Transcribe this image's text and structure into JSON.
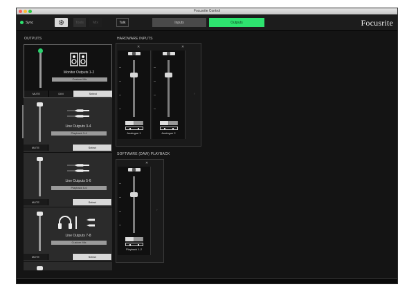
{
  "app": {
    "title": "Focusrite Control"
  },
  "toolbar": {
    "sync_label": "Sync",
    "gear_icon": "gear-icon",
    "btn_disabled_1": "Tools",
    "btn_disabled_2": "Mix",
    "talk_label": "Talk",
    "inputs_label": "Inputs",
    "outputs_label": "Outputs",
    "logo_text": "Focusrite",
    "accent": "#2ee36f"
  },
  "sections": {
    "outputs": "OUTPUTS",
    "hardware_inputs": "HARDWARE INPUTS",
    "software_playback": "SOFTWARE (DAW) PLAYBACK"
  },
  "outputs": [
    {
      "label": "Monitor Outputs 1-2",
      "source": "Custom Mix",
      "icon": "speakers-icon",
      "buttons": [
        "MUTE",
        "DIM",
        "Select"
      ],
      "selected": true
    },
    {
      "label": "Line Outputs 3-4",
      "source": "Playback 3-4",
      "icon": "cables-icon",
      "buttons": [
        "MUTE",
        "Select"
      ],
      "selected": false
    },
    {
      "label": "Line Outputs 5-6",
      "source": "Playback 5-6",
      "icon": "cables-icon",
      "buttons": [
        "MUTE",
        "Select"
      ],
      "selected": false
    },
    {
      "label": "Line Outputs 7-8",
      "source": "Custom Mix",
      "icon": "headphones-cables-icon",
      "buttons": [
        "MUTE",
        "Select"
      ],
      "selected": false
    }
  ],
  "hardware_channels": [
    {
      "name": "Analogue 1",
      "level": 0.25
    },
    {
      "name": "Analogue 2",
      "level": 0.25
    }
  ],
  "software_channels": [
    {
      "name": "Playback 1-2",
      "level": 0.32
    }
  ]
}
